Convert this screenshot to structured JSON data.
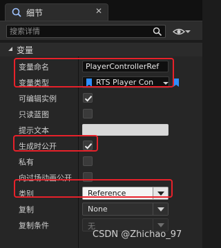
{
  "tab": {
    "title": "细节",
    "close_glyph": "✕",
    "icon": "details-icon"
  },
  "search": {
    "placeholder": "搜索详情"
  },
  "category": {
    "title": "变量"
  },
  "properties": {
    "name_label": "变量命名",
    "name_value": "PlayerControllerRef",
    "type_label": "变量类型",
    "type_value": "RTS Player Con",
    "editable_label": "可编辑实例",
    "readonly_label": "只读蓝图",
    "tooltip_label": "提示文本",
    "expose_spawn_label": "生成时公开",
    "private_label": "私有",
    "expose_cinematic_label": "向过场动画公开",
    "category_label": "类别",
    "category_value": "Reference",
    "replication_label": "复制",
    "replication_value": "None",
    "replication_condition_label": "复制条件",
    "replication_condition_value": "无"
  },
  "checkbox_states": {
    "editable": true,
    "readonly": false,
    "expose_spawn": true,
    "private": false,
    "expose_cinematic": false
  },
  "colors": {
    "highlight": "#e8212a",
    "type_icon": "#2f8fff",
    "panel_bg": "#262626"
  },
  "watermark": "CSDN @Zhichao_97"
}
